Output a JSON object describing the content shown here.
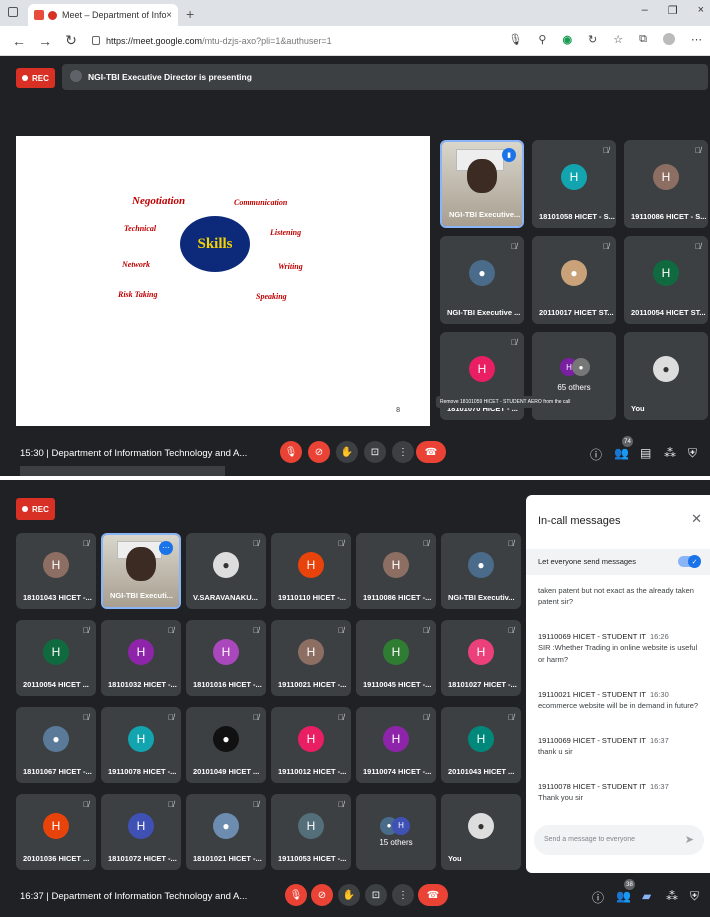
{
  "browser": {
    "tab_title": "Meet – Department of Infor",
    "tab_close": "×",
    "new_tab": "+",
    "url_host": "https://meet.google.com",
    "url_rest": "/mtu-dzjs-axo?pli=1&authuser=1",
    "win_min": "–",
    "win_max": "❐",
    "win_close": "×"
  },
  "meet1": {
    "rec": "REC",
    "presenting": "NGI-TBI Executive Director is presenting",
    "slide": {
      "center": "Skills",
      "words": [
        "Negotiation",
        "Communication",
        "Technical",
        "Listening",
        "Network",
        "Writing",
        "Risk Taking",
        "Speaking"
      ],
      "page": "8"
    },
    "tiles": [
      "NGI-TBI Executive...",
      "18101058 HICET - S...",
      "19110086 HICET - S...",
      "NGI-TBI Executive ...",
      "20110017 HICET ST...",
      "20110054 HICET ST...",
      "18101070 HICET - ..."
    ],
    "avatar_letter": "H",
    "others": "65 others",
    "you": "You",
    "tooltip": "Remove 18101059 HICET - STUDENT AERO from the call",
    "time_title": "15:30  |  Department of Information Technology and A...",
    "people_count": "74"
  },
  "meet2": {
    "rec": "REC",
    "tiles": [
      "18101043 HICET -...",
      "NGI-TBI Executi...",
      "V.SARAVANAKU...",
      "19110110 HICET -...",
      "19110086 HICET -...",
      "NGI-TBI Executiv...",
      "20110054 HICET ...",
      "18101032 HICET -...",
      "18101016 HICET -...",
      "19110021 HICET -...",
      "19110045 HICET -...",
      "18101027 HICET -...",
      "18101067 HICET -...",
      "19110078 HICET -...",
      "20101049 HICET ...",
      "19110012 HICET -...",
      "19110074 HICET -...",
      "20101043 HICET ...",
      "20101036 HICET ...",
      "18101072 HICET -...",
      "18101021 HICET -...",
      "19110053 HICET -..."
    ],
    "avatar_letter": "H",
    "others": "15 others",
    "you": "You",
    "time_title": "16:37  |  Department of Information Technology and A...",
    "people_count": "38"
  },
  "chat": {
    "title": "In-call messages",
    "let_everyone": "Let everyone send messages",
    "partial": "taken patent but not exact as the already taken patent sir?",
    "messages": [
      {
        "sender": "19110069 HICET - STUDENT IT",
        "time": "16:26",
        "text": "SIR :Whether Trading in online website is useful or harm?"
      },
      {
        "sender": "19110021 HICET - STUDENT IT",
        "time": "16:30",
        "text": "ecommerce  website will  be in demand in future?"
      },
      {
        "sender": "19110069 HICET - STUDENT IT",
        "time": "16:37",
        "text": "thank u sir"
      },
      {
        "sender": "19110078 HICET - STUDENT IT",
        "time": "16:37",
        "text": "Thank you sir"
      }
    ],
    "placeholder": "Send a message to everyone"
  },
  "colors": {
    "meet_bg": "#202124",
    "tile_bg": "#3c4043",
    "rec_red": "#d93025",
    "end_red": "#ea4335",
    "accent_blue": "#1a73e8"
  }
}
